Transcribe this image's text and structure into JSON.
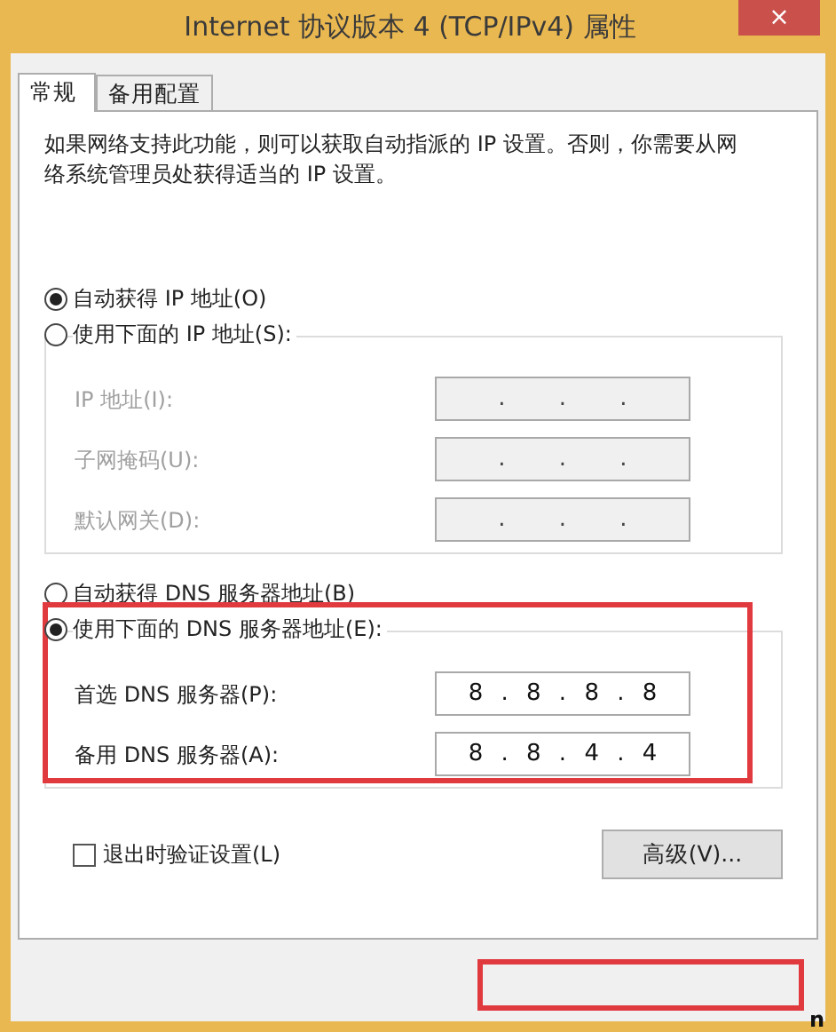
{
  "window": {
    "title": "Internet 协议版本 4 (TCP/IPv4) 属性",
    "close": "×"
  },
  "tabs": [
    {
      "label": "常规",
      "selected": true
    },
    {
      "label": "备用配置",
      "selected": false
    }
  ],
  "description": "如果网络支持此功能，则可以获取自动指派的 IP 设置。否则，你需要从网络系统管理员处获得适当的 IP 设置。",
  "ip_options": [
    {
      "label": "自动获得 IP 地址(O)",
      "selected": true
    },
    {
      "label": "使用下面的 IP 地址(S):",
      "selected": false
    }
  ],
  "ip_fields": [
    {
      "label": "IP 地址(I):",
      "value": ". . .",
      "disabled": true
    },
    {
      "label": "子网掩码(U):",
      "value": ". . .",
      "disabled": true
    },
    {
      "label": "默认网关(D):",
      "value": ". . .",
      "disabled": true
    }
  ],
  "dns_options": [
    {
      "label": "自动获得 DNS 服务器地址(B)",
      "selected": false
    },
    {
      "label": "使用下面的 DNS 服务器地址(E):",
      "selected": true
    }
  ],
  "dns_fields": [
    {
      "label": "首选 DNS 服务器(P):",
      "value": "8 . 8 . 8 . 8",
      "disabled": false
    },
    {
      "label": "备用 DNS 服务器(A):",
      "value": "8 . 8 . 4 . 4",
      "disabled": false
    }
  ],
  "validate_checkbox": {
    "label": "退出时验证设置(L)",
    "checked": false
  },
  "advanced_button": "高级(V)...",
  "annotations": [
    {
      "kind": "dns-box"
    },
    {
      "kind": "buttons-box",
      "text": "n"
    }
  ]
}
